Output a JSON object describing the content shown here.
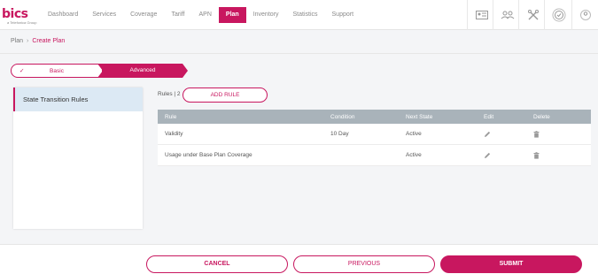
{
  "app": {
    "logo_text": "bics",
    "logo_tagline": "a Telefonica Group"
  },
  "nav": {
    "items": [
      "Dashboard",
      "Services",
      "Coverage",
      "Tariff",
      "APN",
      "Plan",
      "Inventory",
      "Statistics",
      "Support"
    ],
    "active": "Plan"
  },
  "toolbar_icons": [
    "id-card-icon",
    "users-icon",
    "tools-icon",
    "badge-icon",
    "user-icon"
  ],
  "breadcrumb": {
    "root": "Plan",
    "current": "Create Plan"
  },
  "steps": {
    "step1": "Basic",
    "step2": "Advanced"
  },
  "sidebar": {
    "item": "State Transition Rules"
  },
  "rules": {
    "count_label": "Rules | 2",
    "add_button": "ADD RULE"
  },
  "table": {
    "headers": {
      "rule": "Rule",
      "condition": "Condition",
      "next_state": "Next State",
      "edit": "Edit",
      "delete": "Delete"
    },
    "rows": [
      {
        "rule": "Validity",
        "condition": "10 Day",
        "next_state": "Active"
      },
      {
        "rule": "Usage under Base Plan Coverage",
        "condition": "",
        "next_state": "Active"
      }
    ]
  },
  "footer": {
    "cancel": "CANCEL",
    "previous": "PREVIOUS",
    "submit": "SUBMIT"
  },
  "colors": {
    "accent": "#c8175f",
    "header_gray": "#a9b3ba",
    "selected_bg": "#dce9f4"
  }
}
